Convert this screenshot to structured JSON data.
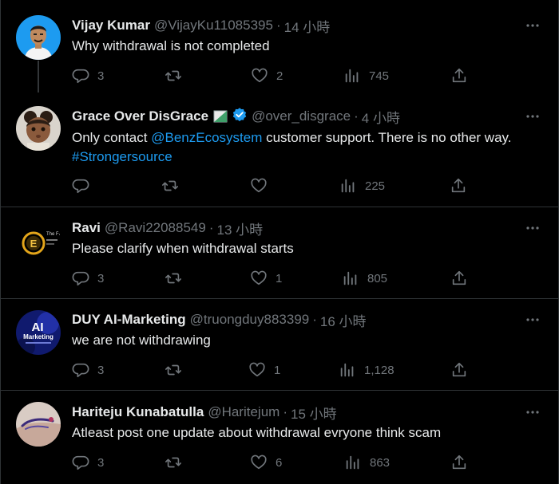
{
  "tweets": [
    {
      "name": "Vijay Kumar",
      "handle": "@VijayKu11085395",
      "time": "14 小時",
      "text": "Why withdrawal is not completed",
      "replies": "3",
      "retweets": "",
      "likes": "2",
      "views": "745"
    },
    {
      "name": "Grace Over DisGrace",
      "handle": "@over_disgrace",
      "time": "4 小時",
      "text_before": "Only contact ",
      "mention": "@BenzEcosystem",
      "text_after": " customer support. There is no other way.",
      "hashtag": "#Strongersource",
      "replies": "",
      "retweets": "",
      "likes": "",
      "views": "225",
      "verified": true
    },
    {
      "name": "Ravi",
      "handle": "@Ravi22088549",
      "time": "13 小時",
      "text": "Please clarify when withdrawal starts",
      "replies": "3",
      "retweets": "",
      "likes": "1",
      "views": "805",
      "avatar_text": "The Fi"
    },
    {
      "name": "DUY AI-Marketing",
      "handle": "@truongduy883399",
      "time": "16 小時",
      "text": "we are not withdrawing",
      "replies": "3",
      "retweets": "",
      "likes": "1",
      "views": "1,128",
      "avatar_line1": "AI",
      "avatar_line2": "Marketing"
    },
    {
      "name": "Hariteju Kunabatulla",
      "handle": "@Haritejum",
      "time": "15 小時",
      "text": "Atleast post one update about withdrawal evryone think scam",
      "replies": "3",
      "retweets": "",
      "likes": "6",
      "views": "863"
    }
  ],
  "separator": "·",
  "icons": {
    "reply": "reply-icon",
    "retweet": "retweet-icon",
    "like": "heart-icon",
    "views": "views-icon",
    "share": "share-icon",
    "more": "more-icon",
    "verified": "verified-badge-icon"
  },
  "colors": {
    "background": "#000000",
    "text": "#e7e9ea",
    "muted": "#71767b",
    "link": "#1d9bf0",
    "border": "#2f3336"
  }
}
